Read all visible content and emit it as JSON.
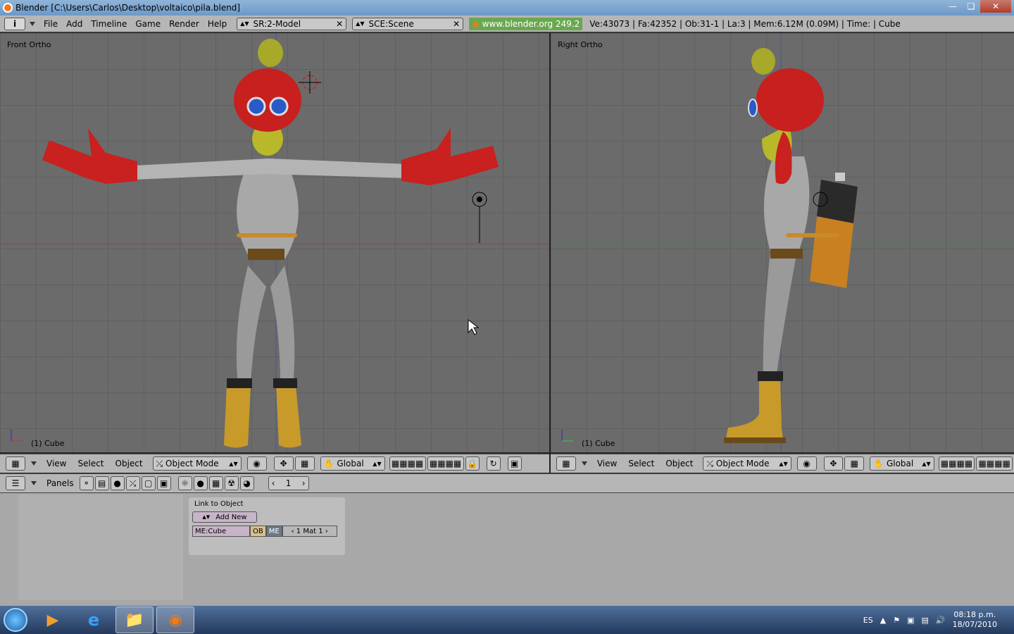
{
  "window": {
    "title": "Blender [C:\\Users\\Carlos\\Desktop\\voltaico\\pila.blend]"
  },
  "header": {
    "menus": [
      "File",
      "Add",
      "Timeline",
      "Game",
      "Render",
      "Help"
    ],
    "screen_field": "SR:2-Model",
    "scene_field": "SCE:Scene",
    "website": "www.blender.org 249.2",
    "stats": "Ve:43073 | Fa:42352 | Ob:31-1 | La:3  | Mem:6.12M (0.09M)  | Time: | Cube"
  },
  "viewports": {
    "left": {
      "label": "Front Ortho",
      "object": "(1) Cube"
    },
    "right": {
      "label": "Right Ortho",
      "object": "(1) Cube"
    }
  },
  "view_header": {
    "menus": [
      "View",
      "Select",
      "Object"
    ],
    "mode": "Object Mode",
    "orientation": "Global"
  },
  "buttons_header": {
    "panels_label": "Panels",
    "frame": "1"
  },
  "link_panel": {
    "title": "Link to Object",
    "add_new": "Add New",
    "mesh_name": "ME:Cube",
    "ob": "OB",
    "me": "ME",
    "mat": "1 Mat 1"
  },
  "taskbar": {
    "lang": "ES",
    "time": "08:18 p.m.",
    "date": "18/07/2010"
  },
  "colors": {
    "accent": "#6aa84f",
    "viewport_bg": "#6b6b6b"
  }
}
